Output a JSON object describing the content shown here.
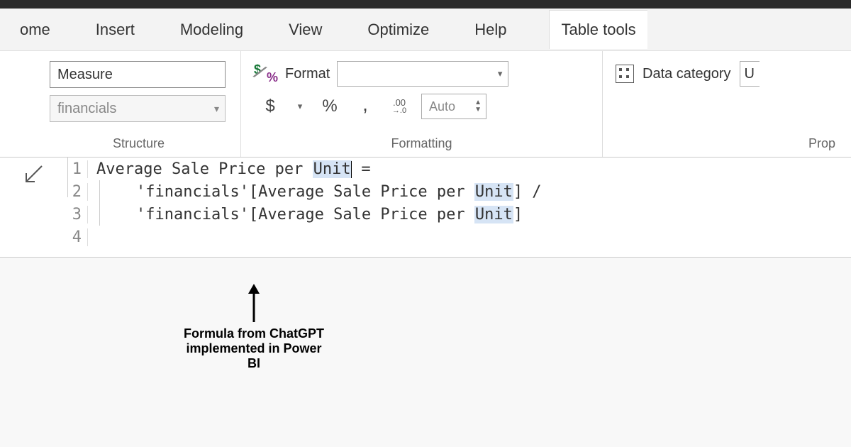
{
  "tabs": {
    "home_partial": "ome",
    "insert": "Insert",
    "modeling": "Modeling",
    "view": "View",
    "optimize": "Optimize",
    "help": "Help",
    "table_tools": "Table tools"
  },
  "structure": {
    "name_value": "Measure",
    "table_value": "financials",
    "group_label": "Structure"
  },
  "formatting": {
    "format_label": "Format",
    "format_value": "",
    "decimal_value": "Auto",
    "group_label": "Formatting"
  },
  "properties": {
    "datacat_label": "Data category",
    "datacat_value_partial": "U",
    "group_label_partial": "Prop"
  },
  "formula": {
    "lines": [
      {
        "n": "1",
        "prefix": "Average Sale Price per ",
        "hl": "Unit",
        "suffix": " ="
      },
      {
        "n": "2",
        "indent": true,
        "prefix": "'financials'[Average Sale Price per ",
        "hl": "Unit",
        "suffix": "] /"
      },
      {
        "n": "3",
        "indent": true,
        "prefix": "'financials'[Average Sale Price per ",
        "hl": "Unit",
        "suffix": "]"
      },
      {
        "n": "4",
        "prefix": "",
        "hl": "",
        "suffix": ""
      }
    ]
  },
  "annotation": {
    "text": "Formula from ChatGPT implemented in Power BI"
  }
}
